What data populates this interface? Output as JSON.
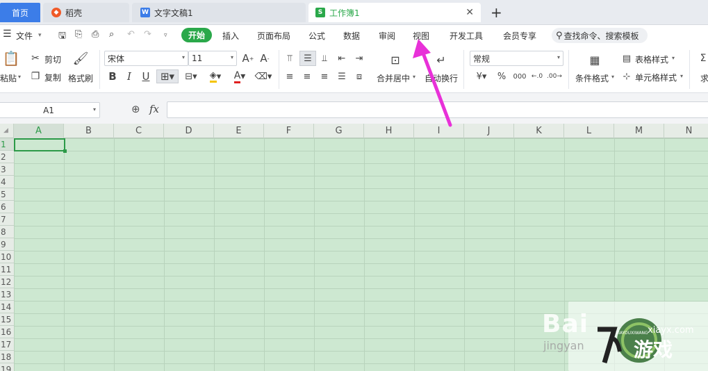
{
  "tabs": {
    "home": "首页",
    "daoke": "稻壳",
    "doc": "文字文稿1",
    "book": "工作簿1",
    "close": "✕",
    "add": "+"
  },
  "menu": {
    "file": "文件",
    "start": "开始",
    "insert": "插入",
    "layout": "页面布局",
    "formula": "公式",
    "data": "数据",
    "review": "审阅",
    "view": "视图",
    "dev": "开发工具",
    "member": "会员专享",
    "search": "查找命令、搜索模板"
  },
  "ribbon": {
    "paste": "粘贴",
    "cut": "剪切",
    "copy": "复制",
    "format_painter": "格式刷",
    "font_name": "宋体",
    "font_size": "11",
    "merge_center": "合并居中",
    "wrap_text": "自动换行",
    "number_format": "常规",
    "cond_format": "条件格式",
    "table_style": "表格样式",
    "cell_style": "单元格样式",
    "sum_partial": "求"
  },
  "formula_bar": {
    "name_box": "A1",
    "fx": "fx"
  },
  "sheet": {
    "columns": [
      "A",
      "B",
      "C",
      "D",
      "E",
      "F",
      "G",
      "H",
      "I",
      "J",
      "K",
      "L",
      "M",
      "N"
    ],
    "rows": [
      "1",
      "2",
      "3",
      "4",
      "5",
      "6",
      "7",
      "8",
      "9",
      "10",
      "11",
      "12",
      "13",
      "14",
      "15",
      "16",
      "17",
      "18",
      "19"
    ]
  },
  "watermark": {
    "baidu": "Bai",
    "jingyan": "jingyan",
    "site": "xiayx.com",
    "logo_text": "游戏",
    "logo_small": "XIAYOUXIWANG"
  },
  "colors": {
    "accent_green": "#2aa84a",
    "home_tab_blue": "#3c7de8",
    "sheet_bg": "#cde8d1",
    "arrow": "#e831d8"
  }
}
